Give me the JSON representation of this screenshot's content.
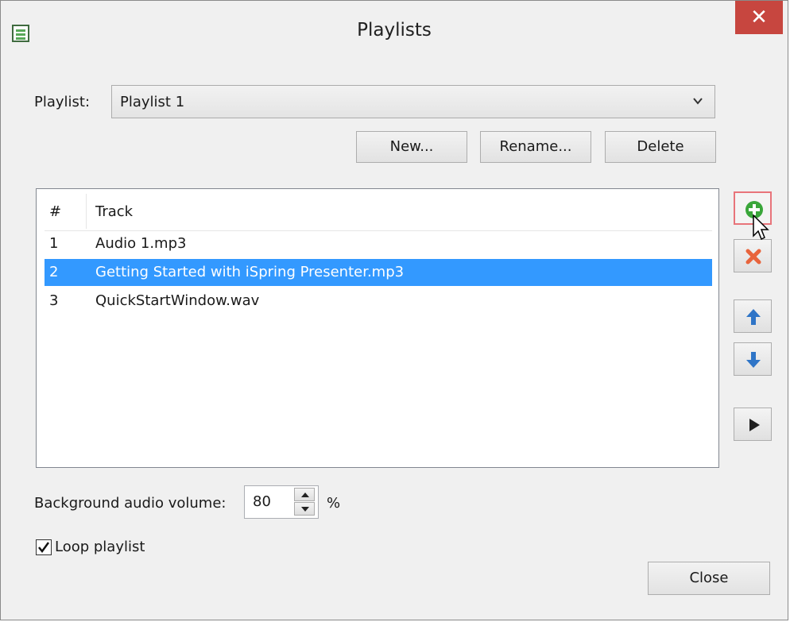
{
  "window": {
    "title": "Playlists",
    "close_glyph": "✕",
    "app_icon": "playlist-app-icon"
  },
  "playlist": {
    "label": "Playlist:",
    "selected": "Playlist 1"
  },
  "buttons": {
    "new": "New...",
    "rename": "Rename...",
    "delete": "Delete",
    "close": "Close"
  },
  "table": {
    "headers": [
      "#",
      "Track"
    ],
    "rows": [
      {
        "num": "1",
        "track": "Audio 1.mp3",
        "selected": false
      },
      {
        "num": "2",
        "track": "Getting Started with iSpring Presenter.mp3",
        "selected": true
      },
      {
        "num": "3",
        "track": "QuickStartWindow.wav",
        "selected": false
      }
    ]
  },
  "side_tools": [
    "add-track-icon",
    "remove-track-icon",
    "move-up-icon",
    "move-down-icon",
    "play-icon"
  ],
  "volume": {
    "label": "Background audio volume:",
    "value": "80",
    "unit": "%"
  },
  "loop": {
    "label": "Loop playlist",
    "checked": true
  },
  "colors": {
    "selection": "#3399ff",
    "close_button": "#c7463f",
    "add_green": "#3aa63a",
    "remove_orange": "#e8643c",
    "arrow_blue": "#2f75c7"
  }
}
